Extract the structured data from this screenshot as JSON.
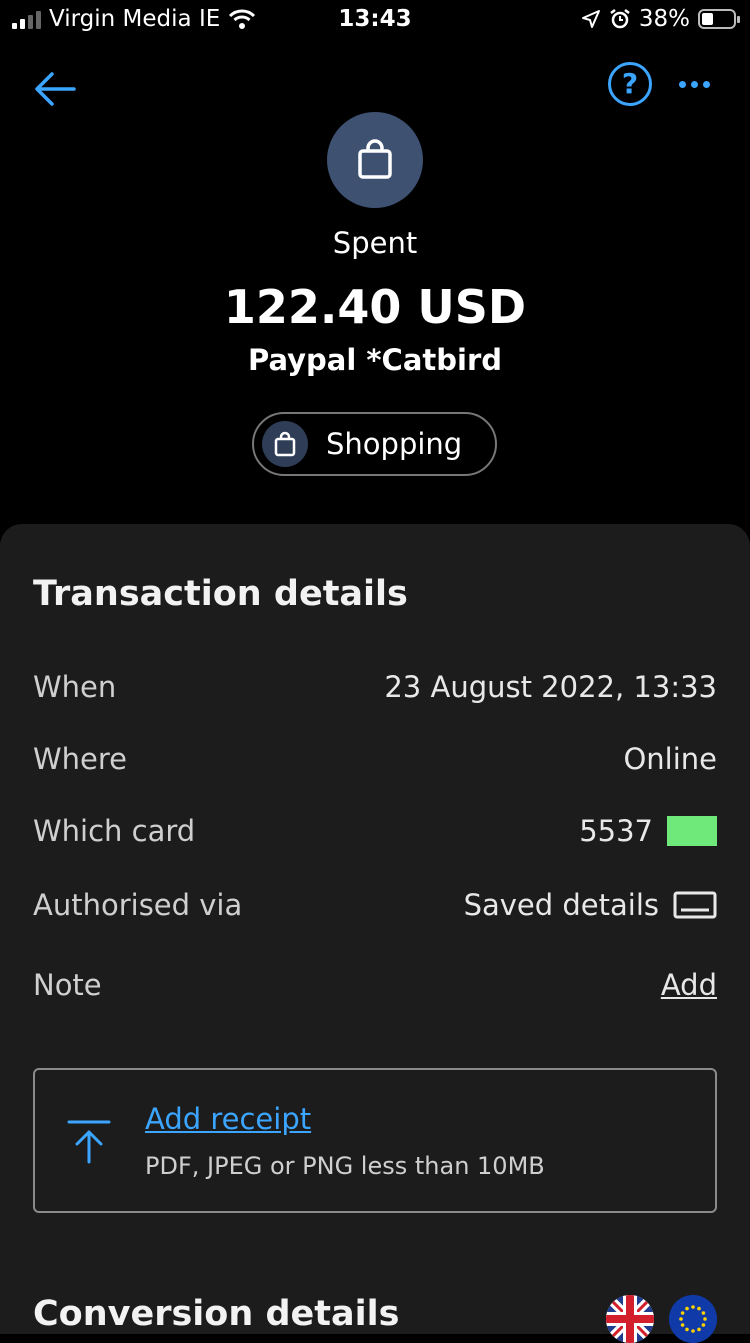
{
  "status_bar": {
    "carrier": "Virgin Media IE",
    "time": "13:43",
    "battery": "38%",
    "battery_level": 0.38
  },
  "nav": {
    "help_label": "?"
  },
  "transaction": {
    "type_label": "Spent",
    "amount": "122.40 USD",
    "merchant": "Paypal *Catbird",
    "category": "Shopping"
  },
  "details": {
    "title": "Transaction details",
    "when_label": "When",
    "when_value": "23 August 2022, 13:33",
    "where_label": "Where",
    "where_value": "Online",
    "card_label": "Which card",
    "card_value": "5537",
    "auth_label": "Authorised via",
    "auth_value": "Saved details",
    "note_label": "Note",
    "note_action": "Add"
  },
  "receipt": {
    "title": "Add receipt",
    "subtitle": "PDF, JPEG or PNG less than 10MB"
  },
  "conversion": {
    "title": "Conversion details"
  },
  "colors": {
    "accent": "#3ba5ff",
    "panel": "#1c1c1c",
    "avatar": "#3e5171",
    "card": "#6ee97a"
  }
}
